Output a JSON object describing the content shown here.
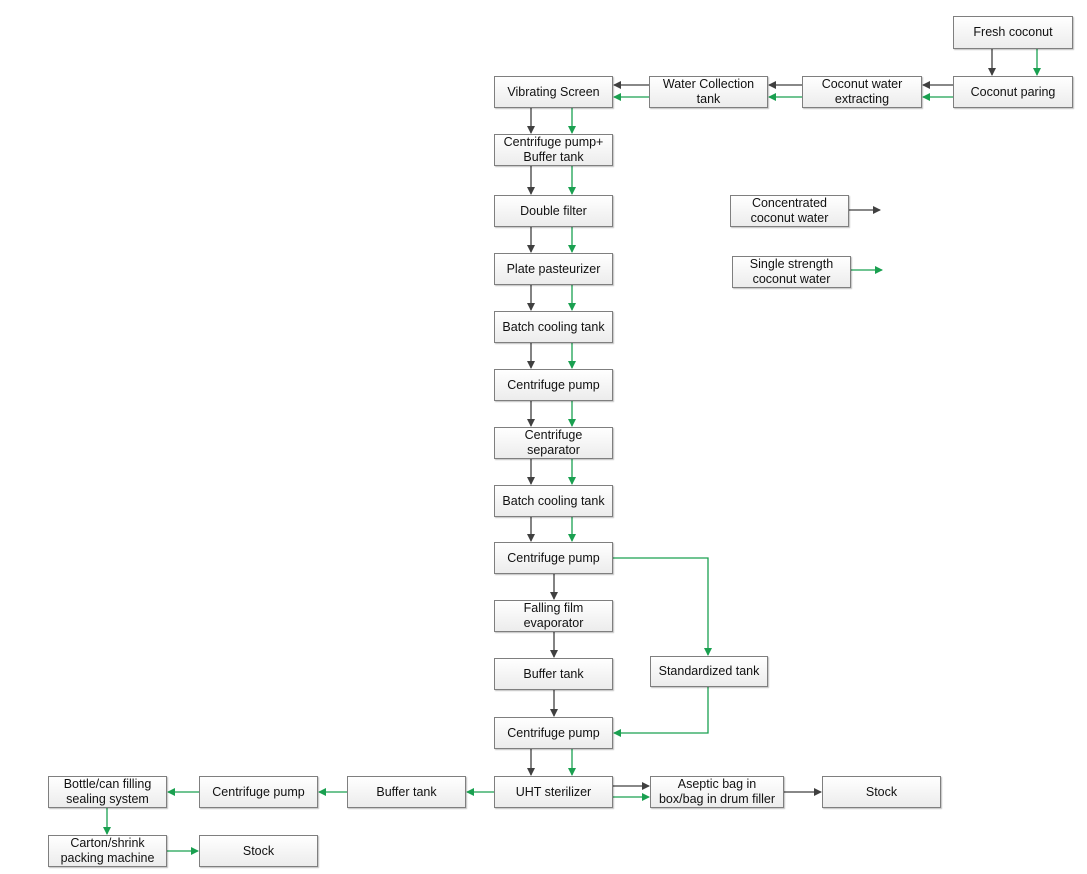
{
  "diagram": {
    "type": "process-flowchart",
    "legend": [
      {
        "id": "legend_concentrated",
        "label": "Concentrated\ncoconut water",
        "color": "#404040"
      },
      {
        "id": "legend_single",
        "label": "Single strength\ncoconut water",
        "color": "#1aa050"
      }
    ],
    "colors": {
      "concentrated": "#404040",
      "single_strength": "#1aa050"
    },
    "nodes": [
      {
        "id": "fresh_coconut",
        "label": "Fresh coconut"
      },
      {
        "id": "coconut_paring",
        "label": "Coconut paring"
      },
      {
        "id": "coconut_water_extracting",
        "label": "Coconut water\nextracting"
      },
      {
        "id": "water_collection_tank",
        "label": "Water Collection\ntank"
      },
      {
        "id": "vibrating_screen",
        "label": "Vibrating Screen"
      },
      {
        "id": "centrifuge_pump_buffer_tank",
        "label": "Centrifuge pump+\nBuffer tank"
      },
      {
        "id": "double_filter",
        "label": "Double filter"
      },
      {
        "id": "plate_pasteurizer",
        "label": "Plate pasteurizer"
      },
      {
        "id": "batch_cooling_tank_1",
        "label": "Batch cooling tank"
      },
      {
        "id": "centrifuge_pump_1",
        "label": "Centrifuge pump"
      },
      {
        "id": "centrifuge_separator",
        "label": "Centrifuge\nseparator"
      },
      {
        "id": "batch_cooling_tank_2",
        "label": "Batch cooling tank"
      },
      {
        "id": "centrifuge_pump_2",
        "label": "Centrifuge pump"
      },
      {
        "id": "falling_film_evaporator",
        "label": "Falling film\nevaporator"
      },
      {
        "id": "buffer_tank_1",
        "label": "Buffer tank"
      },
      {
        "id": "standardized_tank",
        "label": "Standardized tank"
      },
      {
        "id": "centrifuge_pump_3",
        "label": "Centrifuge pump"
      },
      {
        "id": "uht_sterilizer",
        "label": "UHT sterilizer"
      },
      {
        "id": "aseptic_filler",
        "label": "Aseptic bag in\nbox/bag in drum filler"
      },
      {
        "id": "stock_1",
        "label": "Stock"
      },
      {
        "id": "buffer_tank_2",
        "label": "Buffer tank"
      },
      {
        "id": "centrifuge_pump_4",
        "label": "Centrifuge pump"
      },
      {
        "id": "bottle_can_filling",
        "label": "Bottle/can filling\nsealing system"
      },
      {
        "id": "carton_shrink_packing",
        "label": "Carton/shrink\npacking machine"
      },
      {
        "id": "stock_2",
        "label": "Stock"
      }
    ],
    "edges": [
      {
        "from": "fresh_coconut",
        "to": "coconut_paring",
        "flow": "concentrated"
      },
      {
        "from": "fresh_coconut",
        "to": "coconut_paring",
        "flow": "single_strength"
      },
      {
        "from": "coconut_paring",
        "to": "coconut_water_extracting",
        "flow": "concentrated"
      },
      {
        "from": "coconut_paring",
        "to": "coconut_water_extracting",
        "flow": "single_strength"
      },
      {
        "from": "coconut_water_extracting",
        "to": "water_collection_tank",
        "flow": "concentrated"
      },
      {
        "from": "coconut_water_extracting",
        "to": "water_collection_tank",
        "flow": "single_strength"
      },
      {
        "from": "water_collection_tank",
        "to": "vibrating_screen",
        "flow": "concentrated"
      },
      {
        "from": "water_collection_tank",
        "to": "vibrating_screen",
        "flow": "single_strength"
      },
      {
        "from": "vibrating_screen",
        "to": "centrifuge_pump_buffer_tank",
        "flow": "both"
      },
      {
        "from": "centrifuge_pump_buffer_tank",
        "to": "double_filter",
        "flow": "both"
      },
      {
        "from": "double_filter",
        "to": "plate_pasteurizer",
        "flow": "both"
      },
      {
        "from": "plate_pasteurizer",
        "to": "batch_cooling_tank_1",
        "flow": "both"
      },
      {
        "from": "batch_cooling_tank_1",
        "to": "centrifuge_pump_1",
        "flow": "both"
      },
      {
        "from": "centrifuge_pump_1",
        "to": "centrifuge_separator",
        "flow": "both"
      },
      {
        "from": "centrifuge_separator",
        "to": "batch_cooling_tank_2",
        "flow": "both"
      },
      {
        "from": "batch_cooling_tank_2",
        "to": "centrifuge_pump_2",
        "flow": "both"
      },
      {
        "from": "centrifuge_pump_2",
        "to": "falling_film_evaporator",
        "flow": "concentrated"
      },
      {
        "from": "centrifuge_pump_2",
        "to": "standardized_tank",
        "flow": "single_strength"
      },
      {
        "from": "falling_film_evaporator",
        "to": "buffer_tank_1",
        "flow": "concentrated"
      },
      {
        "from": "buffer_tank_1",
        "to": "centrifuge_pump_3",
        "flow": "concentrated"
      },
      {
        "from": "standardized_tank",
        "to": "centrifuge_pump_3",
        "flow": "single_strength"
      },
      {
        "from": "centrifuge_pump_3",
        "to": "uht_sterilizer",
        "flow": "both"
      },
      {
        "from": "uht_sterilizer",
        "to": "aseptic_filler",
        "flow": "both"
      },
      {
        "from": "aseptic_filler",
        "to": "stock_1",
        "flow": "concentrated"
      },
      {
        "from": "uht_sterilizer",
        "to": "buffer_tank_2",
        "flow": "single_strength"
      },
      {
        "from": "buffer_tank_2",
        "to": "centrifuge_pump_4",
        "flow": "single_strength"
      },
      {
        "from": "centrifuge_pump_4",
        "to": "bottle_can_filling",
        "flow": "single_strength"
      },
      {
        "from": "bottle_can_filling",
        "to": "carton_shrink_packing",
        "flow": "single_strength"
      },
      {
        "from": "carton_shrink_packing",
        "to": "stock_2",
        "flow": "single_strength"
      }
    ]
  }
}
